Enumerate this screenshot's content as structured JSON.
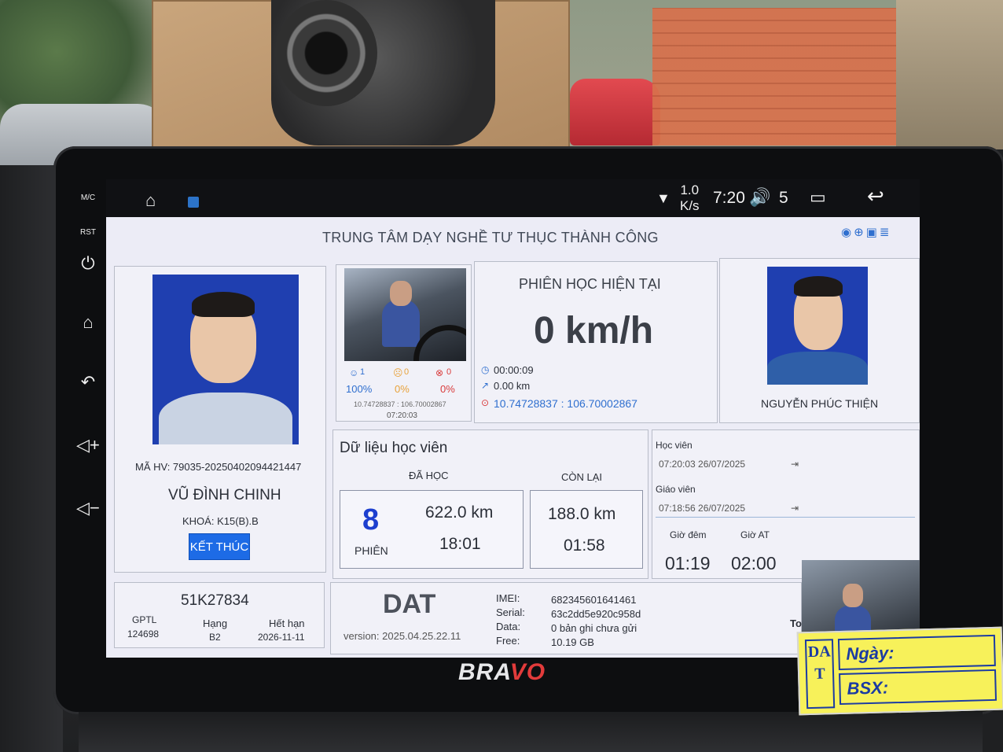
{
  "status_bar": {
    "speed_value": "1.0",
    "speed_unit": "K/s",
    "time": "7:20",
    "volume": "5"
  },
  "bezel": {
    "mic_label": "M/C",
    "rst_label": "RST",
    "brand_prefix": "BRA",
    "brand_suffix": "VO"
  },
  "app": {
    "title": "TRUNG TÂM DẠY NGHỀ TƯ THỤC THÀNH CÔNG"
  },
  "student": {
    "id_label": "MÃ HV: 79035-20250402094421447",
    "name": "VŨ ĐÌNH CHINH",
    "course": "KHOÁ: K15(B).B",
    "end_button": "KẾT THÚC"
  },
  "camera_stats": {
    "good_count": "1",
    "warn_count": "0",
    "bad_count": "0",
    "good_pct": "100%",
    "warn_pct": "0%",
    "bad_pct": "0%",
    "coords": "10.74728837 : 106.70002867",
    "time": "07:20:03",
    "colors": {
      "good": "#2f6fcf",
      "warn": "#e8a23a",
      "bad": "#d93b3b"
    }
  },
  "session": {
    "heading": "PHIÊN HỌC HIỆN TẠI",
    "speed": "0 km/h",
    "elapsed": "00:00:09",
    "distance": "0.00 km",
    "gps": "10.74728837 : 106.70002867"
  },
  "teacher": {
    "name": "NGUYỄN PHÚC THIỆN"
  },
  "student_data": {
    "heading": "Dữ liệu học viên",
    "done_label": "ĐÃ HỌC",
    "remaining_label": "CÒN LẠI",
    "sessions_count": "8",
    "sessions_label": "PHIÊN",
    "done_distance": "622.0 km",
    "done_time": "18:01",
    "remaining_distance": "188.0 km",
    "remaining_time": "01:58"
  },
  "login_times": {
    "student_label": "Học viên",
    "student_time": "07:20:03 26/07/2025",
    "teacher_label": "Giáo viên",
    "teacher_time": "07:18:56 26/07/2025",
    "night_label": "Giờ đêm",
    "auto_label": "Giờ AT",
    "night_value": "01:19",
    "auto_value": "02:00"
  },
  "vehicle": {
    "plate": "51K27834",
    "gptl_label": "GPTL",
    "gptl_value": "124698",
    "class_label": "Hạng",
    "class_value": "B2",
    "expiry_label": "Hết hạn",
    "expiry_value": "2026-11-11"
  },
  "device": {
    "logo": "DAT",
    "version": "version: 2025.04.25.22.11",
    "imei_label": "IMEI:",
    "imei_value": "682345601641461",
    "serial_label": "Serial:",
    "serial_value": "63c2dd5e920c958d",
    "data_label": "Data:",
    "data_value": "0 bản ghi chưa gửi",
    "free_label": "Free:",
    "free_value": "10.19 GB",
    "cut_text": "To"
  },
  "sticker": {
    "letters": "DAT",
    "date_label": "Ngày:",
    "plate_label": "BSX:"
  }
}
